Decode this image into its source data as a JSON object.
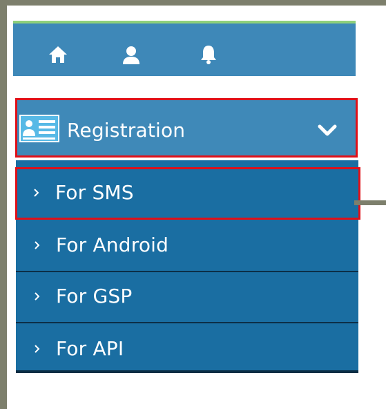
{
  "toolbar": {
    "icons": [
      "home-icon",
      "user-icon",
      "bell-icon"
    ]
  },
  "menu": {
    "header": {
      "label": "Registration",
      "icon": "registration-card-icon",
      "chevron": "chevron-down-icon"
    },
    "items": [
      {
        "label": "For SMS",
        "selected": true
      },
      {
        "label": "For Android",
        "selected": false
      },
      {
        "label": "For GSP",
        "selected": false
      },
      {
        "label": "For API",
        "selected": false
      }
    ]
  },
  "colors": {
    "outer_background": "#7d7f6c",
    "toolbar_background": "#3e88b8",
    "toolbar_accent": "#8fd07a",
    "menu_header_background": "#3f89b8",
    "submenu_background": "#1a6ea2",
    "highlight_border": "#e01018",
    "text": "#ffffff"
  }
}
